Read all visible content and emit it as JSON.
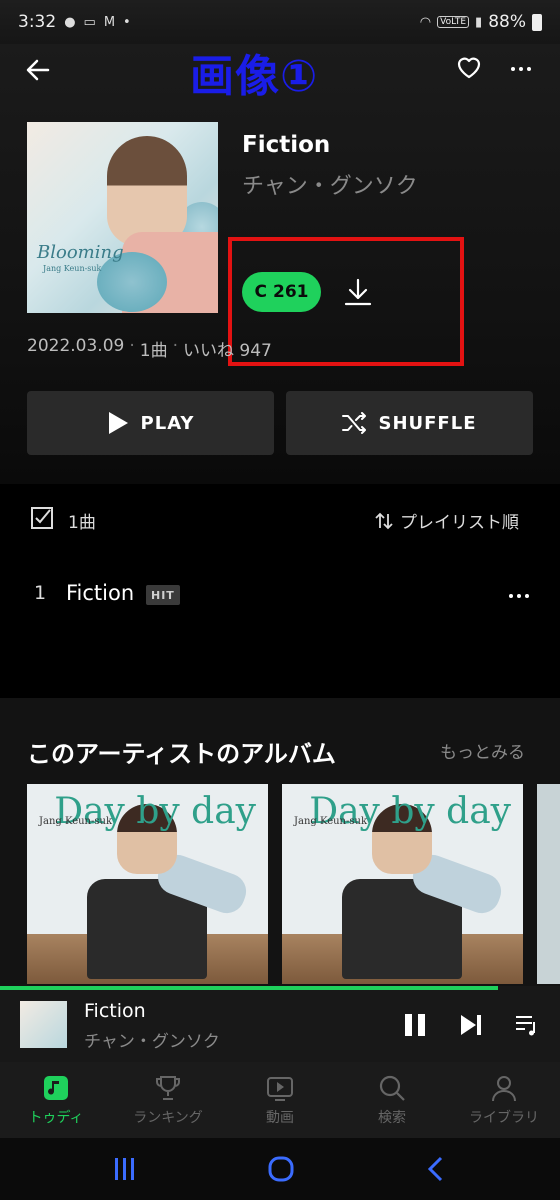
{
  "status_bar": {
    "time": "3:32",
    "battery": "88%",
    "volte": "VoLTE"
  },
  "overlay": {
    "title": "画像①"
  },
  "album": {
    "title": "Fiction",
    "artist": "チャン・グンソク",
    "cover_text": "Blooming",
    "cover_subtext": "Jang Keun-suk",
    "coin_count": "261",
    "coin_symbol": "C",
    "release_date": "2022.03.09",
    "track_count": "1曲",
    "likes": "いいね 947"
  },
  "buttons": {
    "play": "PLAY",
    "shuffle": "SHUFFLE"
  },
  "track_list": {
    "count_label": "1曲",
    "sort_label": "プレイリスト順",
    "tracks": [
      {
        "number": "1",
        "title": "Fiction",
        "badge": "HIT"
      }
    ]
  },
  "artist_albums": {
    "section_title": "このアーティストのアルバム",
    "see_more": "もっとみる",
    "cards": [
      {
        "cover_title": "Day by day",
        "cover_artist": "Jang Keun-suk"
      },
      {
        "cover_title": "Day by day",
        "cover_artist": "Jang Keun-suk"
      }
    ]
  },
  "mini_player": {
    "title": "Fiction",
    "artist": "チャン・グンソク",
    "progress": 0.89
  },
  "tabs": [
    {
      "label": "トゥディ",
      "icon": "music-note-icon",
      "active": true
    },
    {
      "label": "ランキング",
      "icon": "trophy-icon",
      "active": false
    },
    {
      "label": "動画",
      "icon": "video-play-icon",
      "active": false
    },
    {
      "label": "検索",
      "icon": "search-icon",
      "active": false
    },
    {
      "label": "ライブラリ",
      "icon": "person-icon",
      "active": false
    }
  ],
  "colors": {
    "accent": "#1fd15c",
    "overlay_text": "#1a1de8",
    "highlight_box": "#e31212",
    "background": "#000000"
  }
}
